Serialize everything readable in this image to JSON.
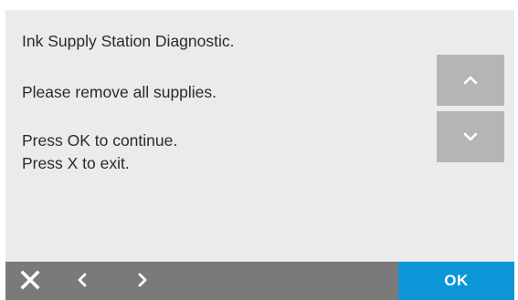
{
  "dialog": {
    "title": "Ink Supply Station Diagnostic.",
    "instruction": "Please remove all supplies.",
    "continue_hint": "Press OK to continue.",
    "exit_hint": "Press X to exit."
  },
  "scroll": {
    "up_icon": "chevron-up-icon",
    "down_icon": "chevron-down-icon"
  },
  "bottom_bar": {
    "close_icon": "close-icon",
    "prev_icon": "chevron-left-icon",
    "next_icon": "chevron-right-icon",
    "ok_label": "OK"
  },
  "colors": {
    "panel_bg": "#ebebeb",
    "scroll_button": "#b5b5b5",
    "bottom_bar": "#7a7a7a",
    "ok_accent": "#0c96d8"
  }
}
